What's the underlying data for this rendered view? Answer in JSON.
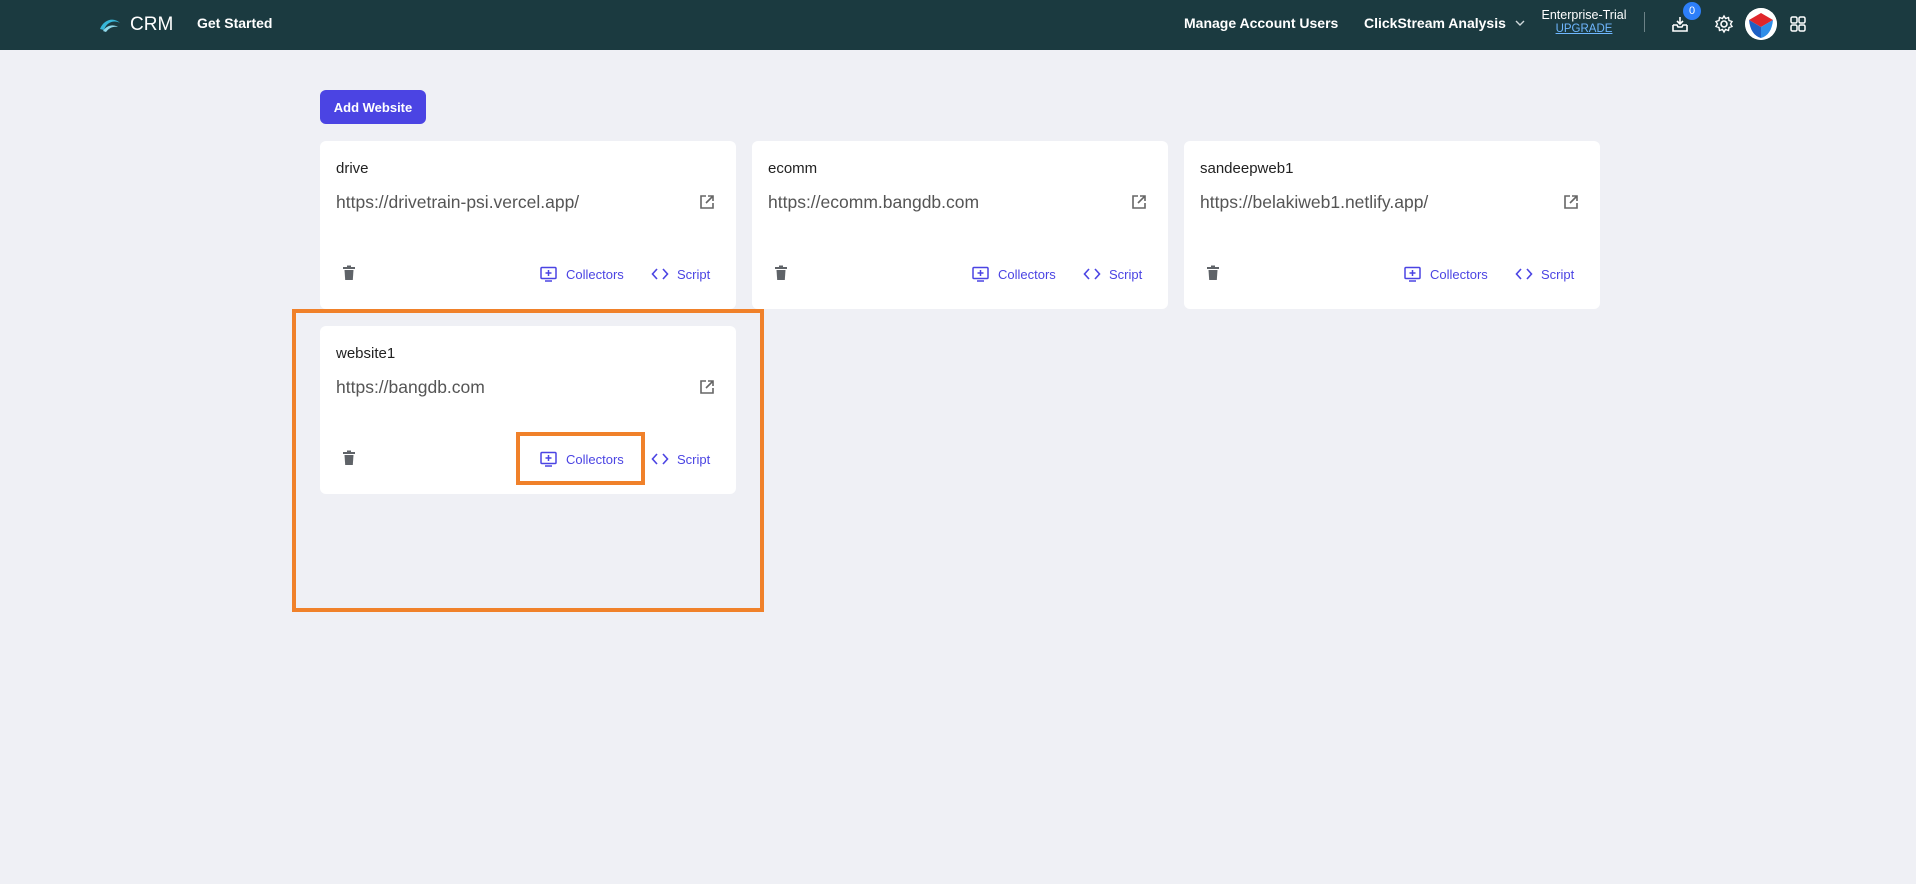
{
  "topbar": {
    "logo_text": "CRM",
    "get_started": "Get Started",
    "manage_users": "Manage Account Users",
    "app_switcher": "ClickStream Analysis",
    "plan_name": "Enterprise-Trial",
    "upgrade": "UPGRADE",
    "inbox_count": "0"
  },
  "actions": {
    "add_website": "Add Website"
  },
  "websites": [
    {
      "name": "drive",
      "url": "https://drivetrain-psi.vercel.app/",
      "collectors_label": "Collectors",
      "script_label": "Script"
    },
    {
      "name": "ecomm",
      "url": "https://ecomm.bangdb.com",
      "collectors_label": "Collectors",
      "script_label": "Script"
    },
    {
      "name": "sandeepweb1",
      "url": "https://belakiweb1.netlify.app/",
      "collectors_label": "Collectors",
      "script_label": "Script"
    },
    {
      "name": "website1",
      "url": "https://bangdb.com",
      "collectors_label": "Collectors",
      "script_label": "Script"
    }
  ],
  "colors": {
    "topbar_bg": "#1b3a40",
    "accent": "#4b44e3",
    "page_bg": "#eff0f5",
    "highlight": "#f0812a"
  }
}
